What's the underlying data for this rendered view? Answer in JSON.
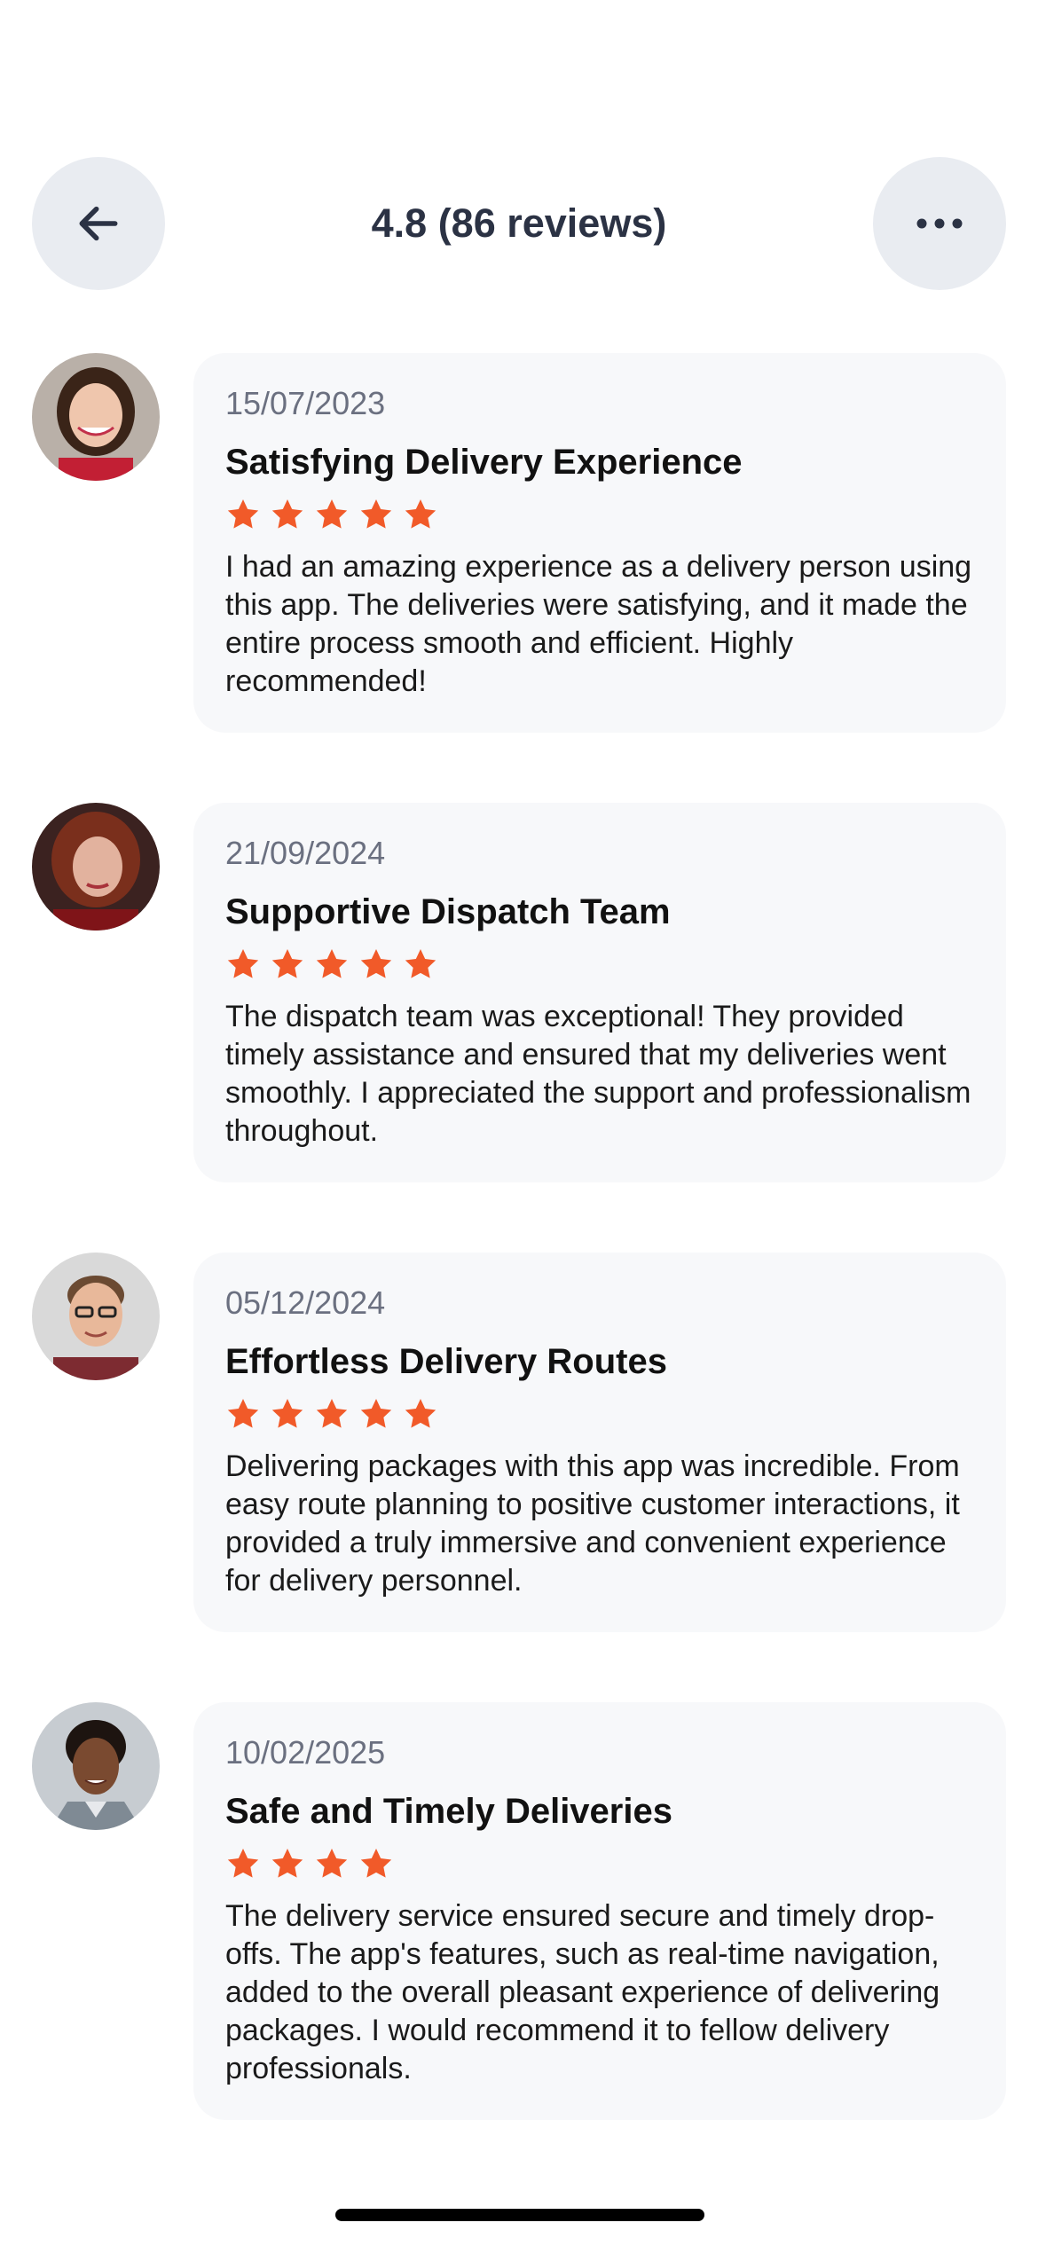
{
  "header": {
    "title": "4.8 (86 reviews)",
    "back_icon": "arrow-left-icon",
    "more_icon": "more-horizontal-icon"
  },
  "colors": {
    "star": "#f15a29",
    "card_bg": "#f7f8fa",
    "icon_button_bg": "#e9ecf1",
    "title_text": "#2b3244"
  },
  "reviews": [
    {
      "date": "15/07/2023",
      "title": "Satisfying Delivery Experience",
      "rating": 5,
      "text": "I had an amazing experience as a delivery person using this app. The deliveries were satisfying, and it made the entire process smooth and efficient. Highly recommended!"
    },
    {
      "date": "21/09/2024",
      "title": "Supportive Dispatch Team",
      "rating": 5,
      "text": "The dispatch team was exceptional! They provided timely assistance and ensured that my deliveries went smoothly. I appreciated the support and professionalism throughout."
    },
    {
      "date": "05/12/2024",
      "title": "Effortless Delivery Routes",
      "rating": 5,
      "text": "Delivering packages with this app was incredible. From easy route planning to positive customer interactions, it provided a truly immersive and convenient experience for delivery personnel."
    },
    {
      "date": "10/02/2025",
      "title": "Safe and Timely Deliveries",
      "rating": 4,
      "text": "The delivery service ensured secure and timely drop-offs. The app's features, such as real-time navigation, added to the overall pleasant experience of delivering packages. I would recommend it to fellow delivery professionals."
    }
  ]
}
